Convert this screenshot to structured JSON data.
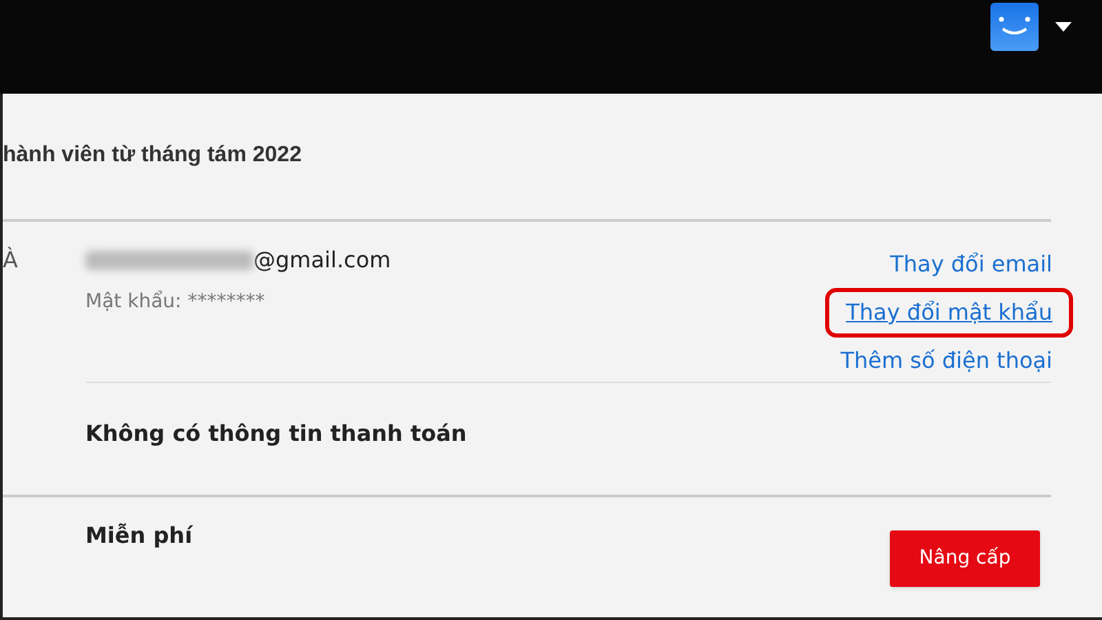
{
  "member_since": "hành viên từ tháng tám 2022",
  "account": {
    "label": "À",
    "email": "@gmail.com",
    "password": "Mật khẩu: ********",
    "links": [
      {
        "label": "Thay đổi email",
        "highlighted": false
      },
      {
        "label": "Thay đổi mật khẩu",
        "highlighted": true
      },
      {
        "label": "Thêm số điện thoại",
        "highlighted": false
      }
    ],
    "billing": "Không có thông tin thanh toán"
  },
  "plan": {
    "name": "Miễn phí",
    "button": "Nâng cấp"
  }
}
